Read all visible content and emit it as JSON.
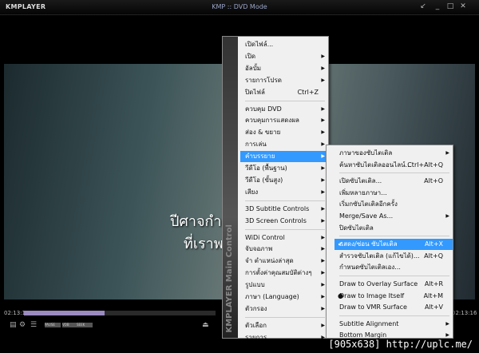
{
  "window": {
    "logo": "KMPLAYER",
    "title": "KMP :: DVD Mode",
    "buttons": [
      "↙",
      "_",
      "□",
      "✕"
    ]
  },
  "video": {
    "subtitle_lines": [
      "ปีศาจกำ",
      "ที่เราพ"
    ]
  },
  "controls": {
    "time_left": "02:13:16",
    "time_right": "02:13:16",
    "progress": 0.42,
    "tags": [
      "PAUSE",
      "VOB",
      "SEEK"
    ]
  },
  "main_menu": {
    "strip_label": "KMPLAYER Main Control",
    "items": [
      {
        "label": "เปิดไฟล์...",
        "shortcut": "",
        "arrow": false
      },
      {
        "label": "เปิด",
        "shortcut": "",
        "arrow": true
      },
      {
        "label": "อัลบั้ม",
        "shortcut": "",
        "arrow": true
      },
      {
        "label": "รายการโปรด",
        "shortcut": "",
        "arrow": true
      },
      {
        "label": "ปิดไฟล์",
        "shortcut": "Ctrl+Z",
        "arrow": false,
        "sep_after": true
      },
      {
        "label": "ควบคุม DVD",
        "shortcut": "",
        "arrow": true
      },
      {
        "label": "ควบคุมการแสดงผล",
        "shortcut": "",
        "arrow": true
      },
      {
        "label": "ส่อง & ขยาย",
        "shortcut": "",
        "arrow": true
      },
      {
        "label": "การเล่น",
        "shortcut": "",
        "arrow": true
      },
      {
        "label": "คำบรรยาย",
        "shortcut": "",
        "arrow": true,
        "highlight": true
      },
      {
        "label": "วีดีโอ (พื้นฐาน)",
        "shortcut": "",
        "arrow": true
      },
      {
        "label": "วีดีโอ (ขั้นสูง)",
        "shortcut": "",
        "arrow": true
      },
      {
        "label": "เสียง",
        "shortcut": "",
        "arrow": true,
        "sep_after": true
      },
      {
        "label": "3D Subtitle Controls",
        "shortcut": "",
        "arrow": true
      },
      {
        "label": "3D Screen Controls",
        "shortcut": "",
        "arrow": true,
        "sep_after": true
      },
      {
        "label": "WiDi Control",
        "shortcut": "",
        "arrow": true
      },
      {
        "label": "จับจอภาพ",
        "shortcut": "",
        "arrow": true
      },
      {
        "label": "จำ ตำแหน่งล่าสุด",
        "shortcut": "",
        "arrow": true
      },
      {
        "label": "การตั้งค่าคุณสมบัติต่างๆ",
        "shortcut": "",
        "arrow": true
      },
      {
        "label": "รูปแบบ",
        "shortcut": "",
        "arrow": true
      },
      {
        "label": "ภาษา (Language)",
        "shortcut": "",
        "arrow": true
      },
      {
        "label": "ตัวกรอง",
        "shortcut": "",
        "arrow": true,
        "sep_after": true
      },
      {
        "label": "ตัวเลือก",
        "shortcut": "",
        "arrow": true
      },
      {
        "label": "รายการ",
        "shortcut": "",
        "arrow": true
      }
    ]
  },
  "sub_menu": {
    "items": [
      {
        "label": "ภาษาของซับไตเติล",
        "shortcut": "",
        "arrow": true
      },
      {
        "label": "ค้นหาซับไตเติลออนไลน์...",
        "shortcut": "Ctrl+Alt+Q",
        "arrow": false,
        "sep_after": true
      },
      {
        "label": "เปิดซับไตเติล...",
        "shortcut": "Alt+O",
        "arrow": false
      },
      {
        "label": "เพิ่มหลายภาษา...",
        "shortcut": "",
        "arrow": false
      },
      {
        "label": "เริ่มกซับไตเติลอีกครั้ง",
        "shortcut": "",
        "arrow": false
      },
      {
        "label": "Merge/Save As...",
        "shortcut": "",
        "arrow": true
      },
      {
        "label": "ปิดซับไตเติล",
        "shortcut": "",
        "arrow": false,
        "sep_after": true
      },
      {
        "label": "แสดง/ซ่อน ซับไตเติล",
        "shortcut": "Alt+X",
        "arrow": false,
        "highlight": true,
        "mark": "✔"
      },
      {
        "label": "สำรวจซับไตเติล (แก้ไขได้)...",
        "shortcut": "Alt+Q",
        "arrow": false
      },
      {
        "label": "กำหนดซับไตเติลเอง...",
        "shortcut": "",
        "arrow": false,
        "sep_after": true
      },
      {
        "label": "Draw to Overlay Surface",
        "shortcut": "Alt+R",
        "arrow": false
      },
      {
        "label": "Draw to Image Itself",
        "shortcut": "Alt+M",
        "arrow": false,
        "mark": "●"
      },
      {
        "label": "Draw to VMR Surface",
        "shortcut": "Alt+V",
        "arrow": false,
        "sep_after": true
      },
      {
        "label": "Subtitle Alignment",
        "shortcut": "",
        "arrow": true
      },
      {
        "label": "Bottom Margin",
        "shortcut": "",
        "arrow": true
      }
    ]
  },
  "watermark": "[905x638] http://uplc.me/"
}
